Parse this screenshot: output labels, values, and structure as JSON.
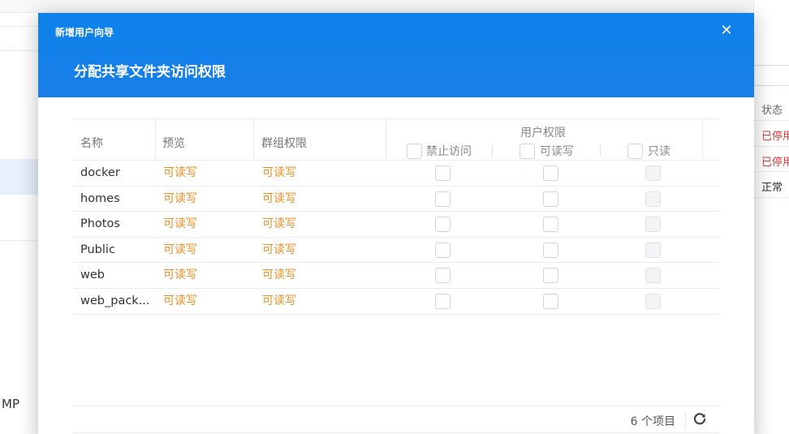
{
  "background": {
    "left_partial_text": "MP",
    "right_header": "状态",
    "right_rows": [
      {
        "text": "已停用",
        "color": "#e03c3c"
      },
      {
        "text": "已停用",
        "color": "#e03c3c"
      },
      {
        "text": "正常",
        "color": "#333333"
      }
    ]
  },
  "modal": {
    "wizard_title": "新增用户向导",
    "step_title": "分配共享文件夹访问权限",
    "close_icon": "close-icon"
  },
  "table": {
    "columns": {
      "name": "名称",
      "preview": "预览",
      "group_permission": "群组权限",
      "user_permission": "用户权限",
      "no_access": "禁止访问",
      "read_write": "可读写",
      "read_only": "只读"
    },
    "rows": [
      {
        "name": "docker",
        "preview": "可读写",
        "group": "可读写"
      },
      {
        "name": "homes",
        "preview": "可读写",
        "group": "可读写"
      },
      {
        "name": "Photos",
        "preview": "可读写",
        "group": "可读写"
      },
      {
        "name": "Public",
        "preview": "可读写",
        "group": "可读写"
      },
      {
        "name": "web",
        "preview": "可读写",
        "group": "可读写"
      },
      {
        "name": "web_pack...",
        "preview": "可读写",
        "group": "可读写"
      }
    ]
  },
  "footer": {
    "item_count": "6 个项目",
    "refresh_icon": "refresh-icon"
  },
  "colors": {
    "accent": "#1a7ee8",
    "permission_text": "#f08c1e"
  }
}
